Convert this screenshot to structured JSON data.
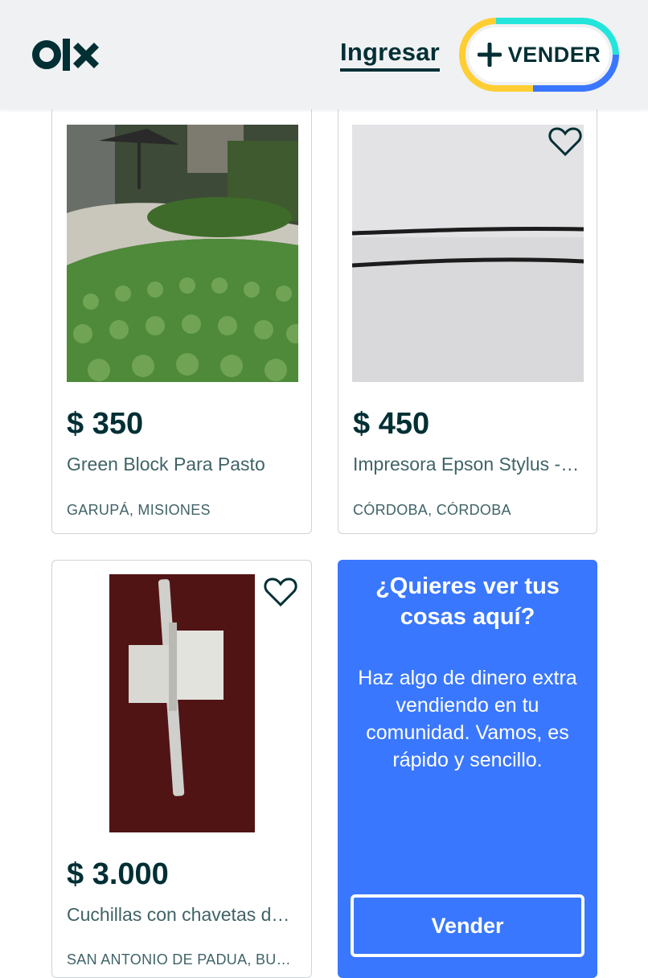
{
  "header": {
    "logo_text": "olx",
    "login_label": "Ingresar",
    "sell_label": "VENDER"
  },
  "listings": [
    {
      "price": "$ 350",
      "title": "Green Block Para Pasto",
      "location": "GARUPÁ, MISIONES"
    },
    {
      "price": "$ 450",
      "title": "Impresora Epson Stylus - Modelo",
      "location": "CÓRDOBA, CÓRDOBA"
    },
    {
      "price": "$ 3.000",
      "title": "Cuchillas con chavetas de hierro",
      "location": "SAN ANTONIO DE PADUA, BUENOS AIRES"
    }
  ],
  "promo": {
    "title": "¿Quieres ver tus cosas aquí?",
    "text": "Haz algo de dinero extra vendiendo en tu comunidad. Vamos, es rápido y sencillo.",
    "button_label": "Vender"
  },
  "colors": {
    "brand_dark": "#002f34",
    "promo_blue": "#3a77ff",
    "ring_teal": "#23e5db",
    "ring_yellow": "#ffce32",
    "ring_blue": "#3a77ff"
  }
}
